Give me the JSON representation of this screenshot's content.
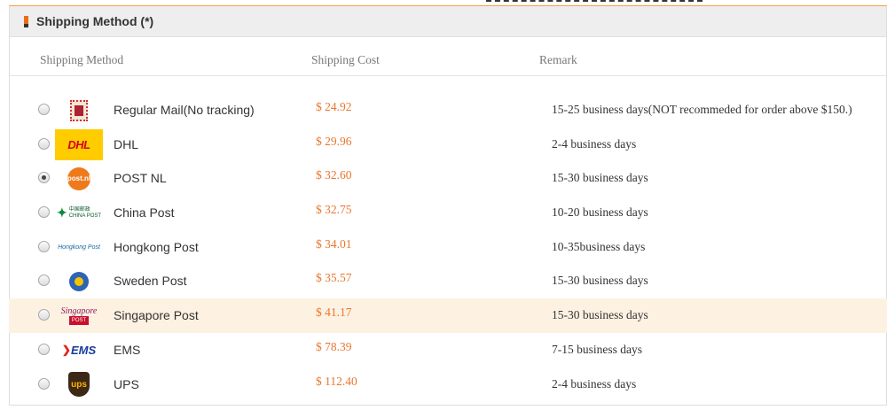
{
  "panel": {
    "title": "Shipping Method (*)"
  },
  "table": {
    "headers": {
      "method": "Shipping Method",
      "cost": "Shipping Cost",
      "remark": "Remark"
    },
    "rows": [
      {
        "name": "Regular Mail(No tracking)",
        "cost": "$ 24.92",
        "remark": "15-25 business days(NOT recommeded for order above $150.)",
        "logo": "stamp-icon",
        "selected": false,
        "highlighted": false
      },
      {
        "name": "DHL",
        "cost": "$ 29.96",
        "remark": "2-4 business days",
        "logo": "dhl-logo",
        "logo_text": "DHL",
        "selected": false,
        "highlighted": false
      },
      {
        "name": "POST NL",
        "cost": "$ 32.60",
        "remark": "15-30 business days",
        "logo": "postnl-logo",
        "logo_text": "post.nl",
        "selected": true,
        "highlighted": false
      },
      {
        "name": "China Post",
        "cost": "$ 32.75",
        "remark": "10-20 business days",
        "logo": "china-post-logo",
        "logo_text": "中国邮政",
        "logo_subtext": "CHINA POST",
        "selected": false,
        "highlighted": false
      },
      {
        "name": "Hongkong Post",
        "cost": "$ 34.01",
        "remark": "10-35business days",
        "logo": "hongkong-post-logo",
        "logo_text": "Hongkong Post",
        "selected": false,
        "highlighted": false
      },
      {
        "name": "Sweden Post",
        "cost": "$ 35.57",
        "remark": "15-30 business days",
        "logo": "sweden-post-logo",
        "selected": false,
        "highlighted": false
      },
      {
        "name": "Singapore Post",
        "cost": "$ 41.17",
        "remark": "15-30 business days",
        "logo": "singapore-post-logo",
        "logo_text": "Singapore",
        "logo_subtext": "POST",
        "selected": false,
        "highlighted": true
      },
      {
        "name": "EMS",
        "cost": "$ 78.39",
        "remark": "7-15 business days",
        "logo": "ems-logo",
        "logo_text": "EMS",
        "selected": false,
        "highlighted": false
      },
      {
        "name": "UPS",
        "cost": "$ 112.40",
        "remark": "2-4 business days",
        "logo": "ups-logo",
        "logo_text": "ups",
        "selected": false,
        "highlighted": false
      }
    ]
  },
  "colors": {
    "accent": "#e86c1a",
    "cost": "#e8772e",
    "highlight_row": "#fdf1e2"
  }
}
